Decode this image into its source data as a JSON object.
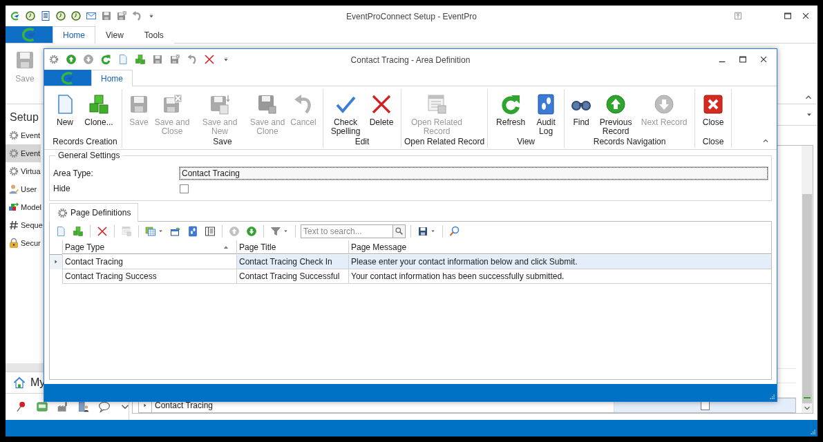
{
  "app": {
    "title": "EventProConnect Setup - EventPro",
    "tabs": [
      {
        "label": "Home",
        "selected": true
      },
      {
        "label": "View",
        "selected": false
      },
      {
        "label": "Tools",
        "selected": false
      }
    ],
    "ribbon_buttons": [
      {
        "label": "Save",
        "disabled": true
      }
    ],
    "sidebar": {
      "title": "Setup",
      "items": [
        {
          "label": "Event",
          "selected": false
        },
        {
          "label": "Event",
          "selected": true
        },
        {
          "label": "Virtua",
          "selected": false
        },
        {
          "label": "User",
          "selected": false
        },
        {
          "label": "Model",
          "selected": false
        },
        {
          "label": "Seque",
          "selected": false
        },
        {
          "label": "Secur",
          "selected": false
        }
      ],
      "footer": "My"
    },
    "grid": {
      "rows": [
        {
          "cells": [
            "Contact Tracing"
          ],
          "checked": false,
          "selected": true
        }
      ]
    }
  },
  "dialog": {
    "title": "Contact Tracing - Area Definition",
    "tabs": [
      {
        "label": "Home",
        "selected": true
      }
    ],
    "ribbon_groups": [
      {
        "label": "Records Creation",
        "buttons": [
          {
            "label": "New",
            "disabled": false
          },
          {
            "label": "Clone...",
            "disabled": false
          }
        ]
      },
      {
        "label": "Save",
        "buttons": [
          {
            "label": "Save",
            "disabled": true
          },
          {
            "label": "Save and Close",
            "disabled": true
          },
          {
            "label": "Save and New",
            "disabled": true
          },
          {
            "label": "Save and Clone",
            "disabled": true
          },
          {
            "label": "Cancel",
            "disabled": true
          }
        ]
      },
      {
        "label": "Edit",
        "buttons": [
          {
            "label": "Check Spelling",
            "disabled": false
          },
          {
            "label": "Delete",
            "disabled": false
          }
        ]
      },
      {
        "label": "Open Related Record",
        "buttons": [
          {
            "label": "Open Related Record",
            "disabled": true
          }
        ]
      },
      {
        "label": "View",
        "buttons": [
          {
            "label": "Refresh",
            "disabled": false
          },
          {
            "label": "Audit Log",
            "disabled": false
          }
        ]
      },
      {
        "label": "Records Navigation",
        "buttons": [
          {
            "label": "Find",
            "disabled": false
          },
          {
            "label": "Previous Record",
            "disabled": false
          },
          {
            "label": "Next Record",
            "disabled": true
          }
        ]
      },
      {
        "label": "Close",
        "buttons": [
          {
            "label": "Close",
            "disabled": false
          }
        ]
      }
    ],
    "general_settings": {
      "title": "General Settings",
      "fields": [
        {
          "kind": "text",
          "label": "Area Type:",
          "value": "Contact Tracing"
        },
        {
          "kind": "checkbox",
          "label": "Hide",
          "checked": false
        }
      ]
    },
    "detail_tabs": [
      {
        "label": "Page Definitions",
        "selected": true
      }
    ],
    "grid": {
      "search": {
        "placeholder": "Text to search..."
      },
      "columns": [
        {
          "label": "Page Type",
          "sorted": true
        },
        {
          "label": "Page Title",
          "sorted": false
        },
        {
          "label": "Page Message",
          "sorted": false
        }
      ],
      "rows": [
        {
          "cells": [
            "Contact Tracing",
            "Contact Tracing Check In",
            "Please enter your contact information below and click Submit."
          ],
          "selected": true
        },
        {
          "cells": [
            "Contact Tracing Success",
            "Contact Tracing Successful",
            "Your contact information has been successfully submitted."
          ],
          "selected": false
        }
      ]
    }
  }
}
